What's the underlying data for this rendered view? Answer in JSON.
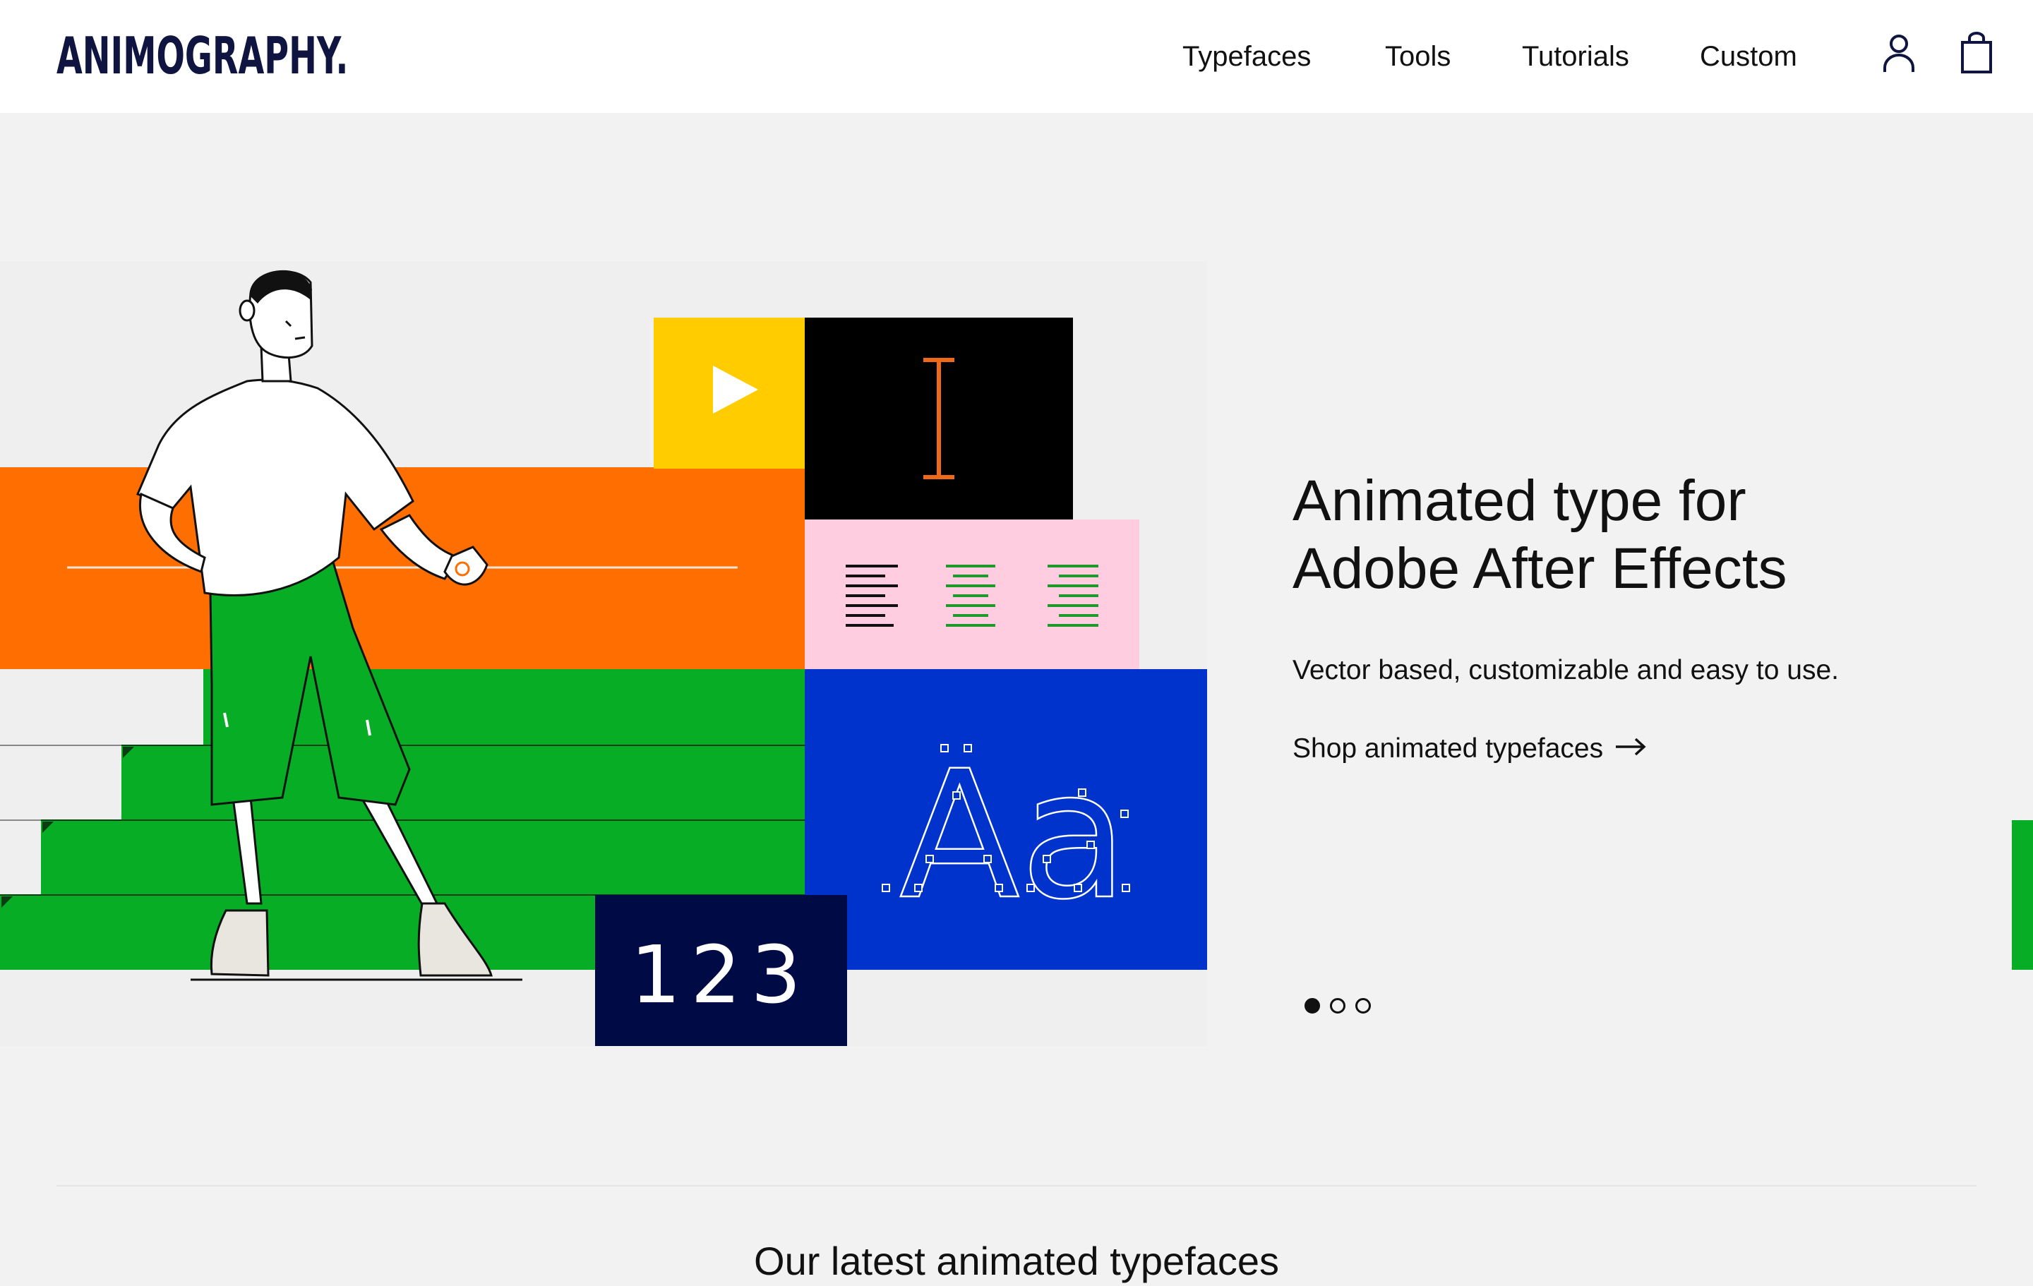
{
  "header": {
    "logo": "ANIMOGRAPHY.",
    "nav": [
      {
        "label": "Typefaces"
      },
      {
        "label": "Tools"
      },
      {
        "label": "Tutorials"
      },
      {
        "label": "Custom"
      }
    ],
    "icons": [
      "user-icon",
      "shopping-bag-icon"
    ]
  },
  "hero": {
    "headline_line1": "Animated type for",
    "headline_line2": "Adobe After Effects",
    "subtitle": "Vector based, customizable and easy to use.",
    "link_label": "Shop animated typefaces",
    "link_icon": "arrow-right-icon",
    "art": {
      "tile_number_text": "123",
      "tile_glyph_text": "Aa",
      "tile_icons": [
        "play-icon",
        "text-cursor-icon",
        "align-left-icon",
        "align-center-icon",
        "align-right-icon"
      ]
    },
    "carousel": {
      "slides": 3,
      "active_index": 0
    }
  },
  "section": {
    "title": "Our latest animated typefaces"
  },
  "colors": {
    "orange": "#ff6e00",
    "green": "#06ad25",
    "yellow": "#ffcc00",
    "black": "#000000",
    "pink": "#ffcce0",
    "blue": "#0033cc",
    "navy": "#000a45",
    "cursor_orange": "#ee6a1a",
    "logo_navy": "#0f1540"
  }
}
